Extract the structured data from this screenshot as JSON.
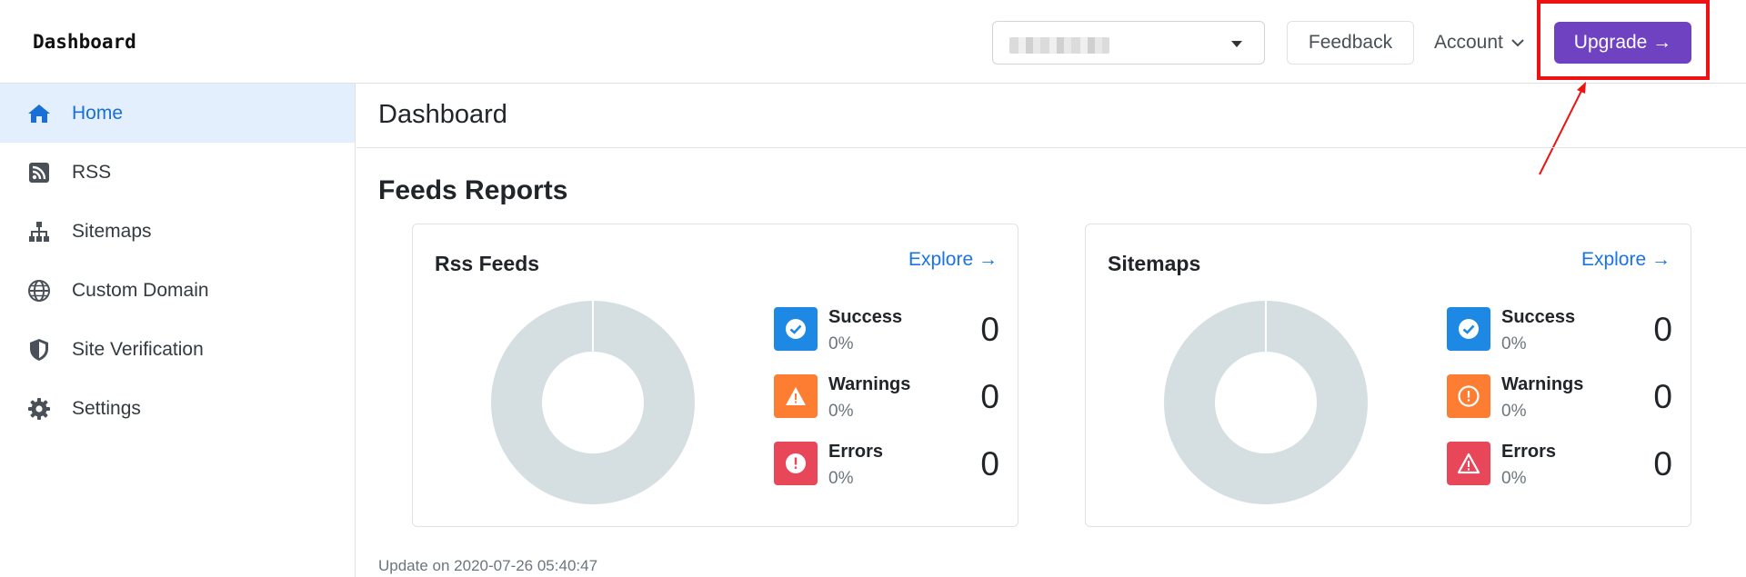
{
  "app": {
    "brand": "Dashboard"
  },
  "header": {
    "feedback_label": "Feedback",
    "account_label": "Account",
    "upgrade_label": "Upgrade →"
  },
  "colors": {
    "accent": "#6f42c1",
    "link": "#1a73e8",
    "success": "#1e88e5",
    "warning": "#fd7e32",
    "error": "#e8475a",
    "donut": "#d5dfe1",
    "annotation": "#ef1212"
  },
  "sidebar": {
    "items": [
      {
        "label": "Home",
        "icon": "home-icon",
        "active": true
      },
      {
        "label": "RSS",
        "icon": "rss-icon"
      },
      {
        "label": "Sitemaps",
        "icon": "sitemap-icon"
      },
      {
        "label": "Custom Domain",
        "icon": "globe-icon"
      },
      {
        "label": "Site Verification",
        "icon": "shield-icon"
      },
      {
        "label": "Settings",
        "icon": "gear-icon"
      }
    ]
  },
  "main": {
    "page_title": "Dashboard",
    "section_title": "Feeds Reports",
    "cards": [
      {
        "title": "Rss Feeds",
        "link": "Explore →",
        "stats": [
          {
            "name": "Success",
            "pct": "0%",
            "count": "0",
            "icon": "check-circle-icon"
          },
          {
            "name": "Warnings",
            "pct": "0%",
            "count": "0",
            "icon": "warning-triangle-icon"
          },
          {
            "name": "Errors",
            "pct": "0%",
            "count": "0",
            "icon": "error-circle-icon"
          }
        ]
      },
      {
        "title": "Sitemaps",
        "link": "Explore →",
        "stats": [
          {
            "name": "Success",
            "pct": "0%",
            "count": "0",
            "icon": "check-circle-icon"
          },
          {
            "name": "Warnings",
            "pct": "0%",
            "count": "0",
            "icon": "exclamation-circle-icon"
          },
          {
            "name": "Errors",
            "pct": "0%",
            "count": "0",
            "icon": "warning-triangle-icon"
          }
        ]
      }
    ],
    "update_note": "Update on 2020-07-26 05:40:47"
  }
}
